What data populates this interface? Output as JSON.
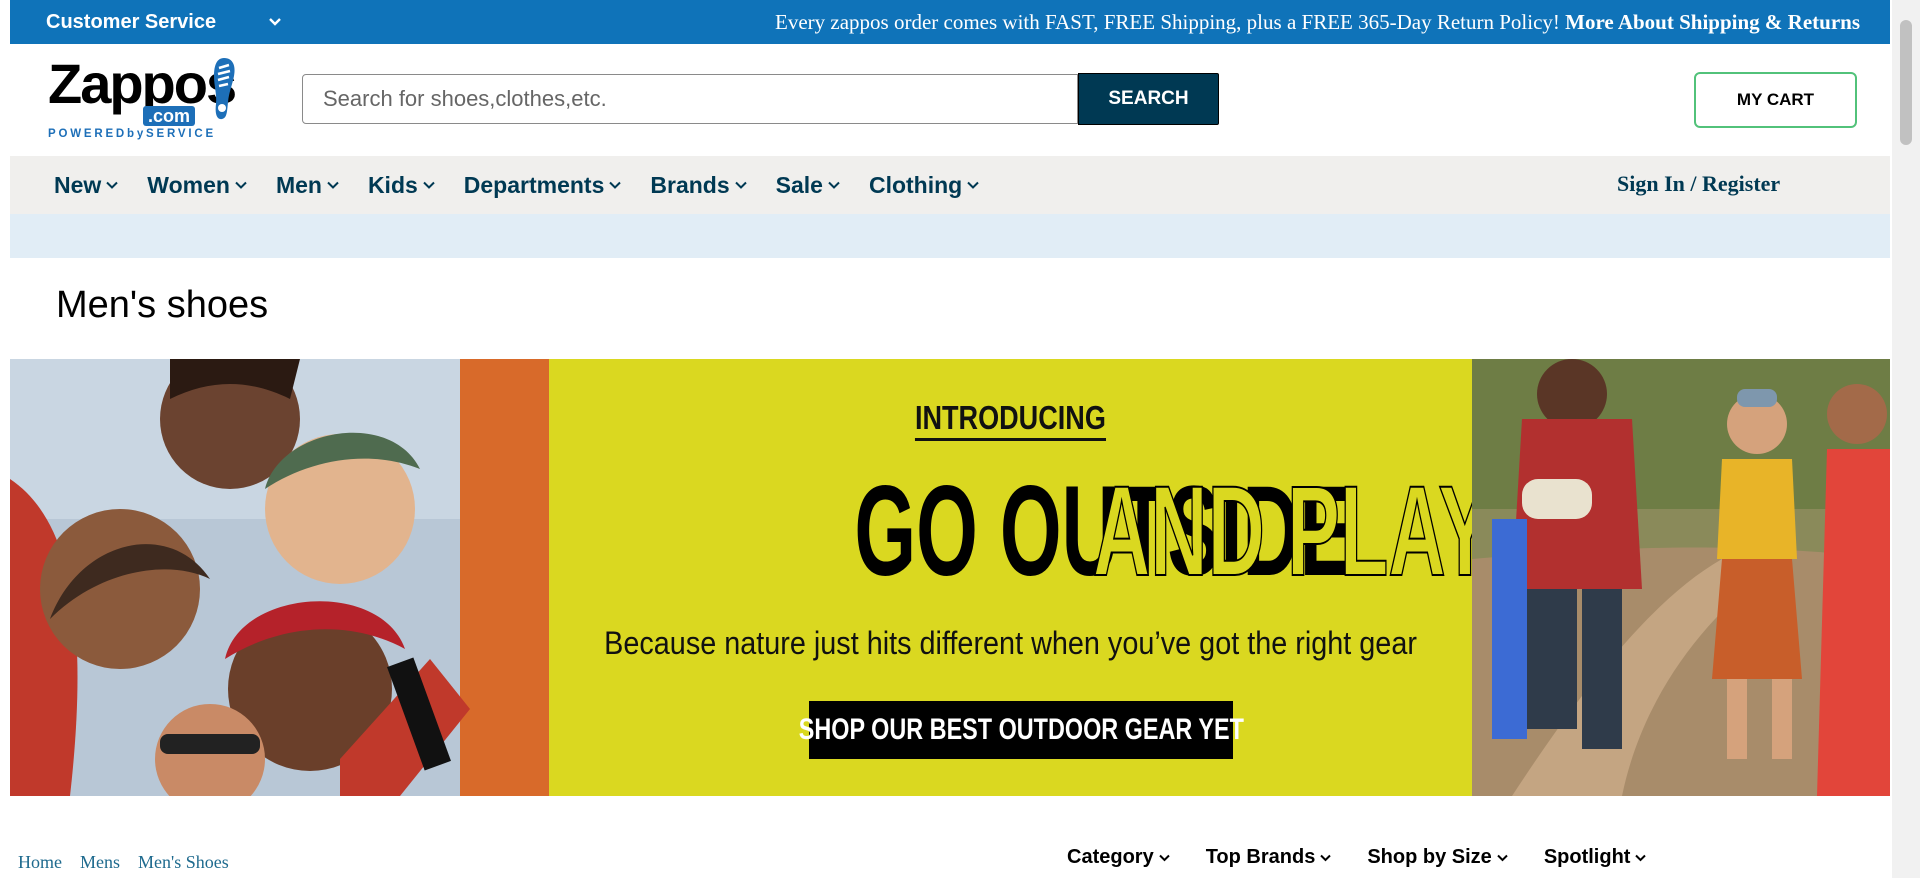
{
  "topbar": {
    "customer_service": "Customer Service",
    "promo_text": "Every zappos order comes with FAST, FREE Shipping, plus a FREE 365-Day Return Policy!",
    "promo_link": "More About Shipping & Returns"
  },
  "header": {
    "logo_word": "Zappos",
    "logo_dotcom": ".com",
    "logo_tagline": "POWEREDbySERVICE",
    "search_placeholder": "Search for shoes,clothes,etc.",
    "search_button": "SEARCH",
    "cart_label": "MY CART"
  },
  "nav": {
    "items": [
      {
        "label": "New"
      },
      {
        "label": "Women"
      },
      {
        "label": "Men"
      },
      {
        "label": "Kids"
      },
      {
        "label": "Departments"
      },
      {
        "label": "Brands"
      },
      {
        "label": "Sale"
      },
      {
        "label": "Clothing"
      }
    ],
    "signin": "Sign In / Register"
  },
  "page": {
    "title": "Men's shoes"
  },
  "hero": {
    "eyebrow": "INTRODUCING",
    "headline_solid": "GO OUTSIDE",
    "headline_outline": "AND PLAY!",
    "subtitle": "Because nature just hits different when you’ve got the right gear",
    "cta": "SHOP OUR BEST OUTDOOR GEAR YET",
    "colors": {
      "background": "#dad820",
      "cta": "#000000"
    }
  },
  "breadcrumb": [
    "Home",
    "Mens",
    "Men's Shoes"
  ],
  "filters": [
    "Category",
    "Top Brands",
    "Shop by Size",
    "Spotlight"
  ],
  "colors": {
    "topbar": "#0f73b9",
    "nav_text": "#003953",
    "search_button": "#003953",
    "cart_border": "#52c27a",
    "subband": "#e1edf6"
  }
}
